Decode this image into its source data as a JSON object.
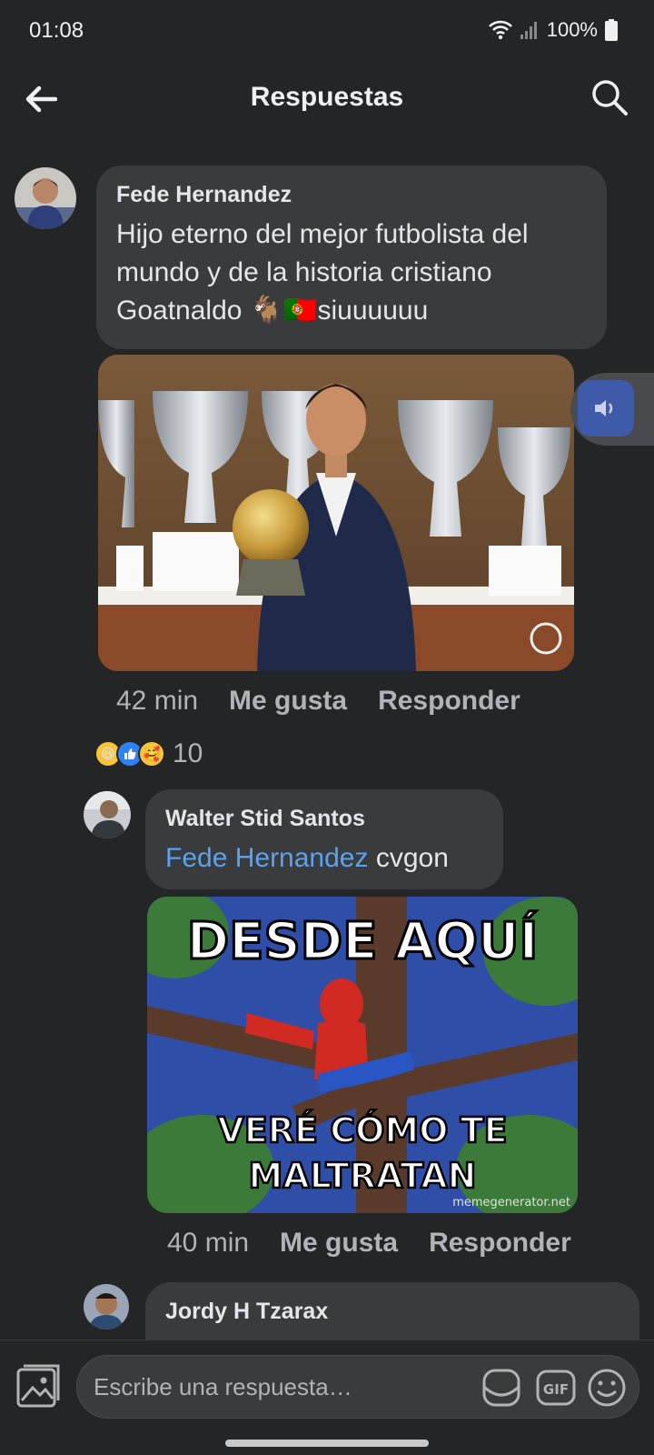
{
  "status_bar": {
    "time": "01:08",
    "battery": "100%"
  },
  "header": {
    "title": "Respuestas",
    "back_icon": "back-arrow-icon",
    "search_icon": "search-icon"
  },
  "comments": [
    {
      "author": "Fede Hernandez",
      "text": "Hijo eterno del mejor futbolista del mundo y de la historia cristiano Goatnaldo 🐐🇵🇹siuuuuuu",
      "time": "42 min",
      "like_label": "Me gusta",
      "reply_label": "Responder",
      "reactions": [
        "haha",
        "like",
        "care"
      ],
      "reaction_count": "10",
      "image_desc": "trophy-photo"
    },
    {
      "author": "Walter Stid Santos",
      "mention": "Fede Hernandez",
      "text": "cvgon",
      "time": "40 min",
      "like_label": "Me gusta",
      "reply_label": "Responder",
      "meme_top": "DESDE AQUÍ",
      "meme_bottom_1": "VERÉ CÓMO TE",
      "meme_bottom_2": "MALTRATAN",
      "meme_watermark": "memegenerator.net"
    },
    {
      "author": "Jordy H Tzarax"
    }
  ],
  "composer": {
    "placeholder": "Escribe una respuesta…",
    "gif_label": "GIF"
  },
  "colors": {
    "background": "#242526",
    "bubble": "#3a3b3c",
    "mention": "#5ba2f0",
    "sound_button": "#3f5aa8"
  }
}
